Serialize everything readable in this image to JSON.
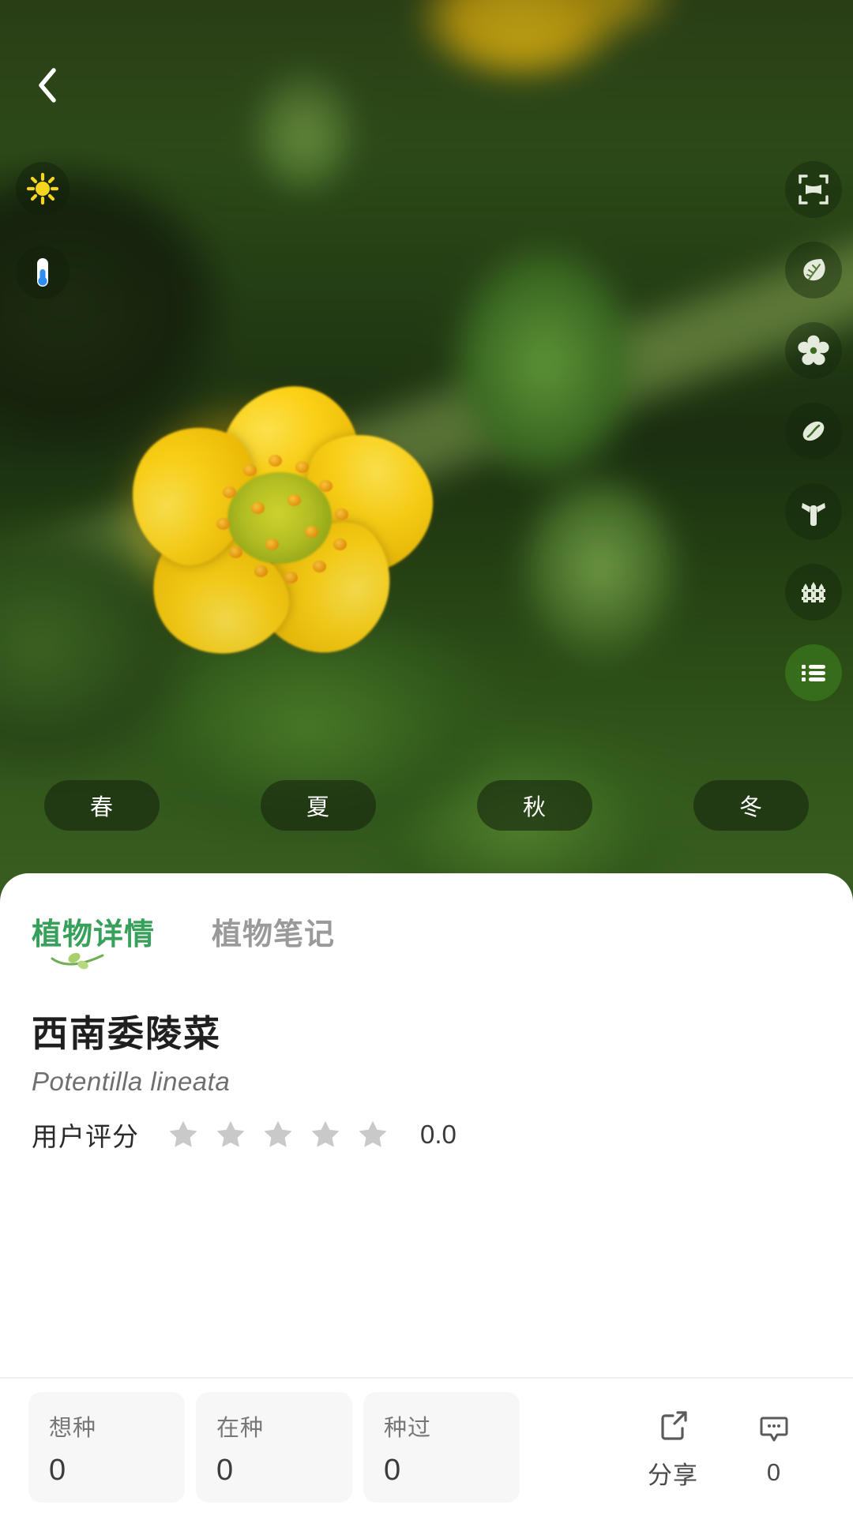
{
  "nav": {
    "back_icon": "chevron-left-icon"
  },
  "overlay_left": [
    {
      "name": "sun-icon",
      "label": "sunlight"
    },
    {
      "name": "thermometer-icon",
      "label": "temperature"
    }
  ],
  "rail": [
    {
      "name": "whole-plant-icon",
      "label": "whole-plant",
      "active": false
    },
    {
      "name": "leaf-icon",
      "label": "leaf",
      "active": false
    },
    {
      "name": "flower-icon",
      "label": "flower",
      "active": false
    },
    {
      "name": "seed-icon",
      "label": "seed",
      "active": false
    },
    {
      "name": "branch-icon",
      "label": "branch",
      "active": false
    },
    {
      "name": "fence-icon",
      "label": "habitat",
      "active": false
    },
    {
      "name": "list-icon",
      "label": "list",
      "active": true
    }
  ],
  "seasons": [
    {
      "label": "春"
    },
    {
      "label": "夏"
    },
    {
      "label": "秋"
    },
    {
      "label": "冬"
    }
  ],
  "tabs": [
    {
      "label": "植物详情",
      "active": true
    },
    {
      "label": "植物笔记",
      "active": false
    }
  ],
  "plant": {
    "chinese_name": "西南委陵菜",
    "scientific_name": "Potentilla lineata",
    "rating_label": "用户评分",
    "rating_value": "0.0",
    "star_count": 5,
    "stars_filled": 0
  },
  "stats": [
    {
      "label": "想种",
      "value": "0"
    },
    {
      "label": "在种",
      "value": "0"
    },
    {
      "label": "种过",
      "value": "0"
    }
  ],
  "actions": [
    {
      "name": "share-icon",
      "label": "分享"
    },
    {
      "name": "comment-icon",
      "label": "0"
    }
  ],
  "colors": {
    "accent_green": "#37a05a",
    "tab_inactive": "#9a9a9a",
    "star_empty": "#c9c9c9",
    "sun_yellow": "#f5d520",
    "chip_bg": "rgba(22,38,14,0.62)"
  }
}
